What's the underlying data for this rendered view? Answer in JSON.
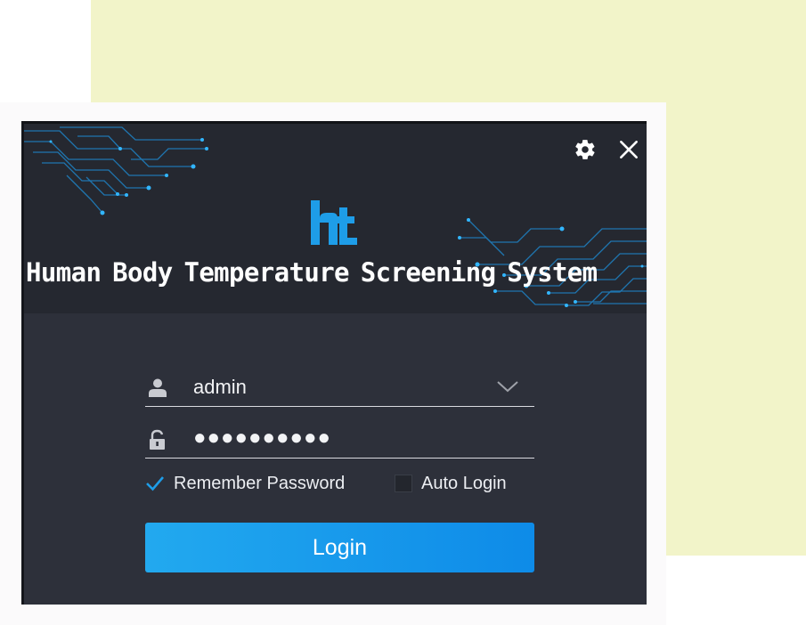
{
  "app": {
    "title": "Human Body Temperature Screening System"
  },
  "window_controls": {
    "settings_icon": "gear-icon",
    "close_icon": "close-icon"
  },
  "login_form": {
    "username": {
      "value": "admin",
      "icon": "user-icon",
      "dropdown_icon": "chevron-down-icon"
    },
    "password": {
      "masked_value": "●●●●●●●●●●",
      "icon": "lock-icon"
    },
    "remember_password": {
      "label": "Remember Password",
      "checked": true
    },
    "auto_login": {
      "label": "Auto Login",
      "checked": false
    },
    "login_button_label": "Login"
  },
  "colors": {
    "accent": "#1a9cec",
    "window_bg": "#2d303a",
    "header_bg": "#252830",
    "circuit": "#1f7fbf",
    "page_highlight": "#f2f4c9"
  }
}
